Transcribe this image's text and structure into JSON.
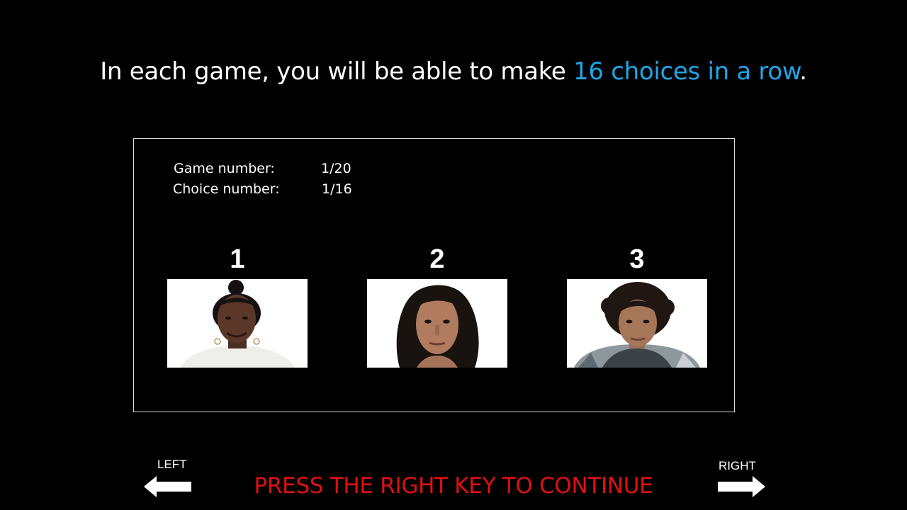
{
  "headline": {
    "prefix": "In each game, you will be able to make ",
    "highlight": "16 choices in a row",
    "suffix": ".",
    "highlight_color": "#1fa6e8"
  },
  "game_info": {
    "game_label": "Game number:",
    "game_value": "1/20",
    "choice_label": "Choice number:",
    "choice_value": "1/16"
  },
  "options": [
    {
      "number": "1",
      "image": "face-photo-1"
    },
    {
      "number": "2",
      "image": "face-photo-2"
    },
    {
      "number": "3",
      "image": "face-photo-3"
    }
  ],
  "controls": {
    "left_label": "LEFT",
    "right_label": "RIGHT",
    "left_icon": "arrow-left-icon",
    "right_icon": "arrow-right-icon",
    "continue_text": "PRESS THE RIGHT KEY TO CONTINUE",
    "continue_color": "#e01010"
  }
}
